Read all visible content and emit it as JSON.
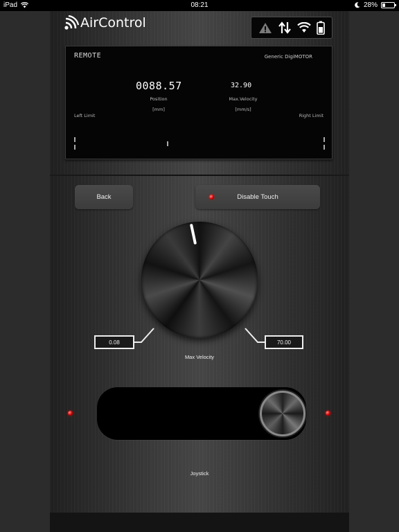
{
  "statusbar": {
    "device": "iPad",
    "time": "08:21",
    "battery": "28%",
    "battery_level": 0.28
  },
  "app": {
    "logo_text": "AirControl"
  },
  "display": {
    "mode": "REMOTE",
    "motor_name": "Generic DigiMOTOR",
    "position_value": "0088.57",
    "position_label": "Position",
    "position_unit": "[mm]",
    "velocity_value": "32.90",
    "velocity_label": "Max.Velocity",
    "velocity_unit": "[mm/s]",
    "left_limit_label": "Left Limit",
    "right_limit_label": "Right Limit"
  },
  "buttons": {
    "back_label": "Back",
    "disable_touch_label": "Disable Touch"
  },
  "velocity_knob": {
    "min_value": "0.08",
    "max_value": "70.00",
    "label": "Max Velocity"
  },
  "joystick": {
    "label": "Joystick"
  },
  "colors": {
    "led_red": "#d10000",
    "display_bg": "#050505"
  },
  "icons": [
    "wifi-icon",
    "moon-icon",
    "battery-icon",
    "warning-icon",
    "up-down-arrows-icon",
    "signal-logo-icon"
  ]
}
